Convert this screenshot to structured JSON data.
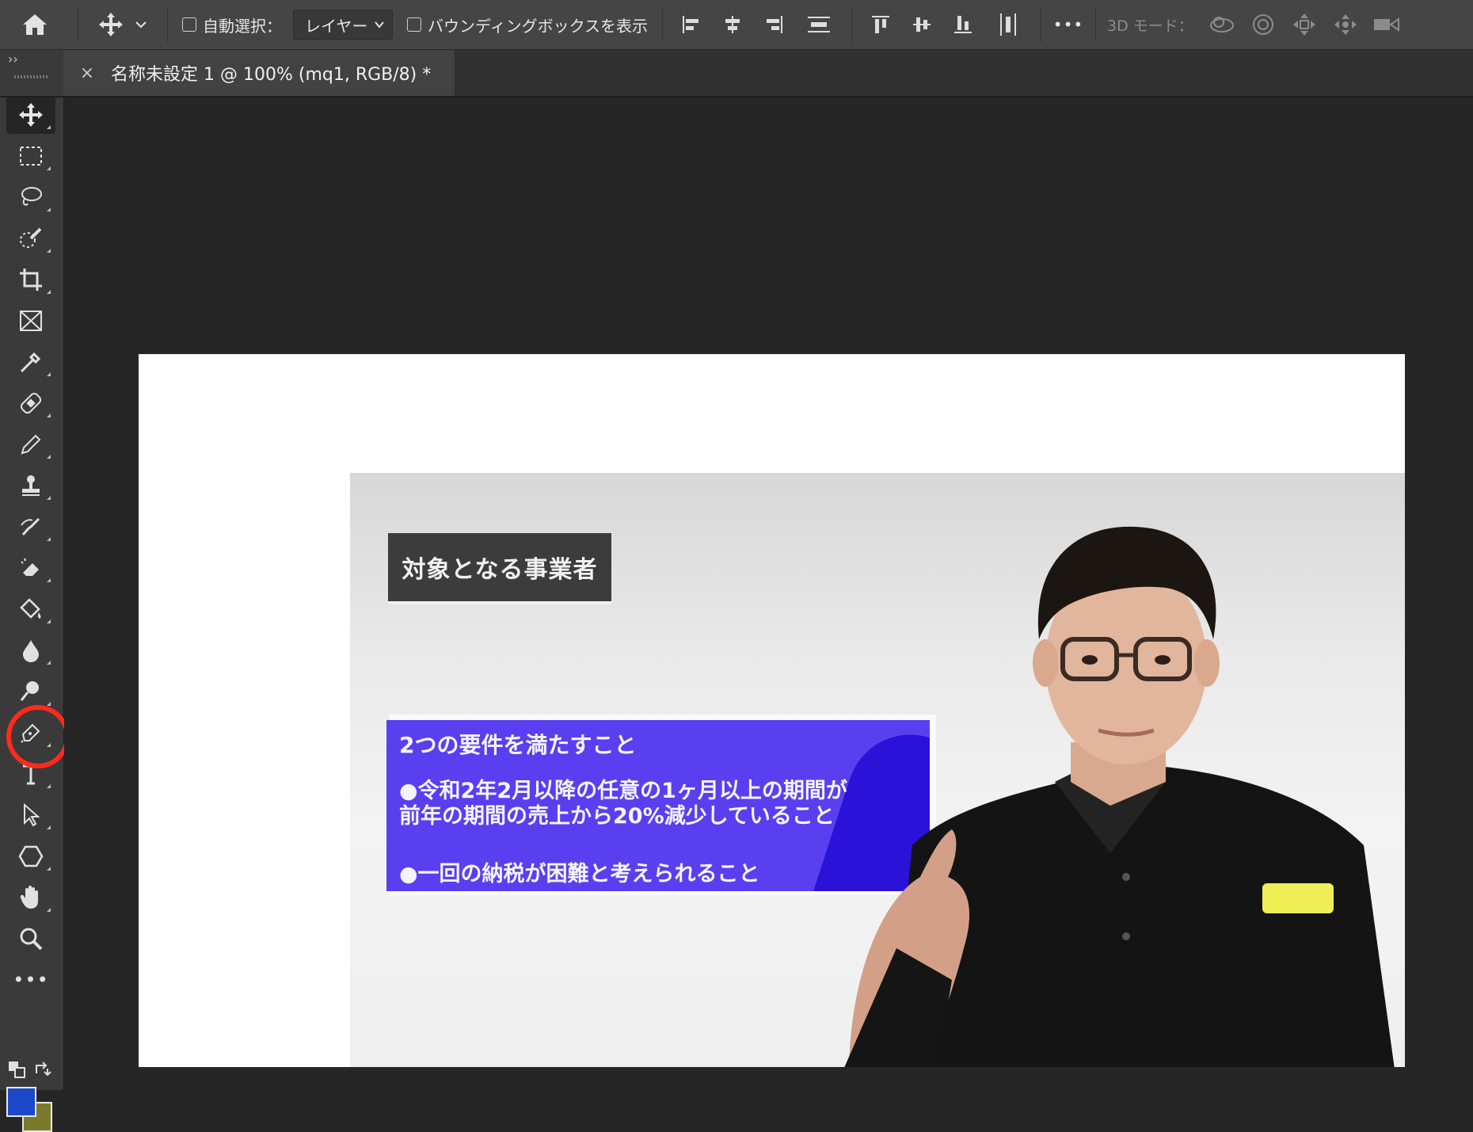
{
  "options_bar": {
    "auto_select_label": "自動選択：",
    "auto_select_value": "レイヤー",
    "bounding_box_label": "バウンディングボックスを表示",
    "more_label": "•••",
    "mode_3d_label": "3D モード："
  },
  "document_tab": {
    "title": "名称未設定 1 @ 100% (mq1, RGB/8) *",
    "close_symbol": "×"
  },
  "toolbar": {
    "collapse_symbol": "››",
    "more_tools_symbol": "•••",
    "foreground_color": "#1b47c8",
    "background_color": "#7b7a2c",
    "highlight_color": "#ff2a1c",
    "active_tool": "move-tool",
    "highlighted_tool": "pen-tool"
  },
  "canvas_image": {
    "title_card": "対象となる事業者",
    "info_heading": "2つの要件を満たすこと",
    "info_point1_line1": "●令和2年2月以降の任意の1ヶ月以上の期間が",
    "info_point1_line2": "前年の期間の売上から20%減少していること",
    "info_point2": "●一回の納税が困難と考えられること"
  }
}
